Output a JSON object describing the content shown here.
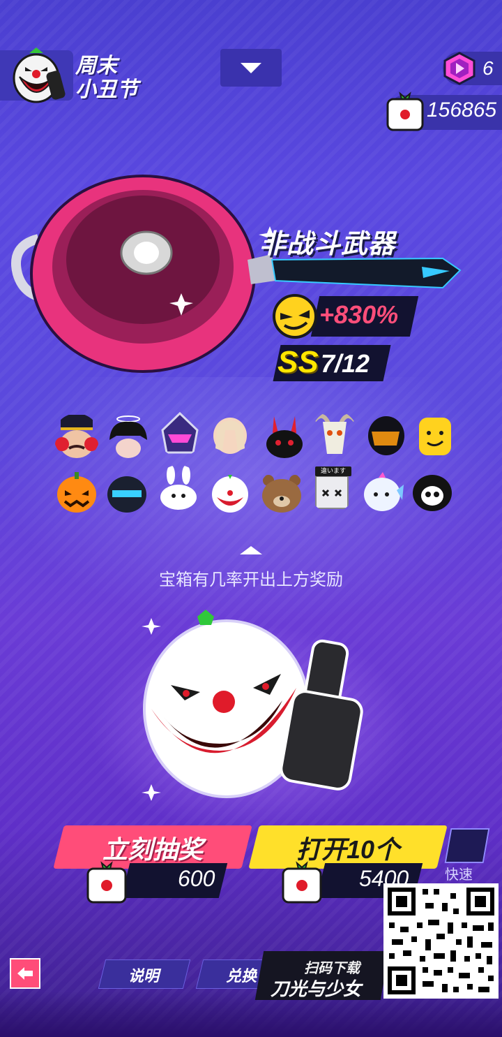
{
  "header": {
    "event_title": "周末\n小丑节",
    "gem_count": "6",
    "coin_count": "156865"
  },
  "weapon": {
    "type_label": "非战斗武器",
    "bonus": "+830%",
    "rank_grade": "SS",
    "rank_count": "7/12"
  },
  "rewards": {
    "items": [
      "nutcracker-mask-icon",
      "black-hair-angel-halo-icon",
      "purple-robot-helmet-icon",
      "blonde-hair-icon",
      "black-rabbit-mask-icon",
      "goat-skull-mask-icon",
      "black-visor-helmet-icon",
      "yellow-brick-head-icon",
      "pumpkin-head-icon",
      "blue-knight-helmet-icon",
      "white-rabbit-mask-icon",
      "clown-mask-icon",
      "bear-head-icon",
      "box-head-icon",
      "fish-head-icon",
      "skull-hood-icon"
    ],
    "box_head_sign": "違います",
    "hint": "宝箱有几率开出上方奖励"
  },
  "actions": {
    "draw_label": "立刻抽奖",
    "draw_price": "600",
    "ten_label": "打开10个",
    "ten_price": "5400",
    "fast_label": "快速"
  },
  "footer": {
    "info_label": "说明",
    "exchange_label": "兑换",
    "promo_top": "扫码下载",
    "promo_bottom": "刀光与少女"
  },
  "colors": {
    "accent_pink": "#ff4d79",
    "accent_yellow": "#ffe02a",
    "background": "#5a48e0"
  }
}
